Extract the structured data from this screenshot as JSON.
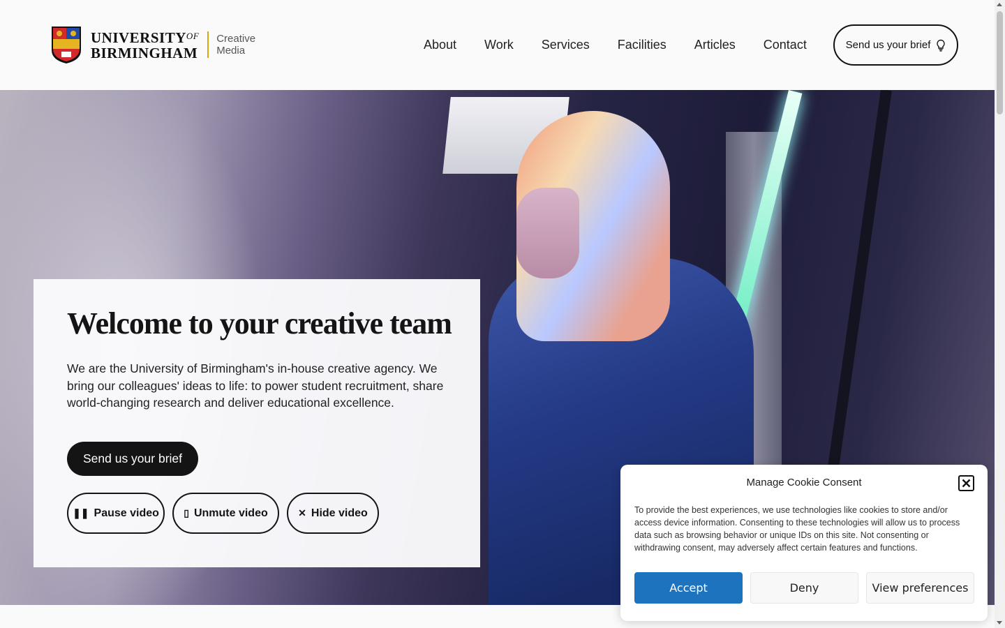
{
  "header": {
    "logo": {
      "university_line1": "UNIVERSITY",
      "university_of": "OF",
      "university_line2": "BIRMINGHAM",
      "sub_line1": "Creative",
      "sub_line2": "Media"
    },
    "nav": [
      {
        "label": "About"
      },
      {
        "label": "Work"
      },
      {
        "label": "Services"
      },
      {
        "label": "Facilities"
      },
      {
        "label": "Articles"
      },
      {
        "label": "Contact"
      }
    ],
    "brief_button": "Send us your brief",
    "brief_icon": "lightbulb-icon"
  },
  "hero": {
    "title": "Welcome to your creative team",
    "text": "We are the University of Birmingham's in-house creative agency. We bring our colleagues' ideas to life: to power student recruitment, share world-changing research and deliver educational excellence.",
    "primary_button": "Send us your brief",
    "video_controls": {
      "pause": "Pause video",
      "unmute": "Unmute video",
      "hide": "Hide video"
    }
  },
  "cookie": {
    "title": "Manage Cookie Consent",
    "text": "To provide the best experiences, we use technologies like cookies to store and/or access device information. Consenting to these technologies will allow us to process data such as browsing behavior or unique IDs on this site. Not consenting or withdrawing consent, may adversely affect certain features and functions.",
    "accept": "Accept",
    "deny": "Deny",
    "preferences": "View preferences",
    "accent_color": "#1e73be"
  }
}
